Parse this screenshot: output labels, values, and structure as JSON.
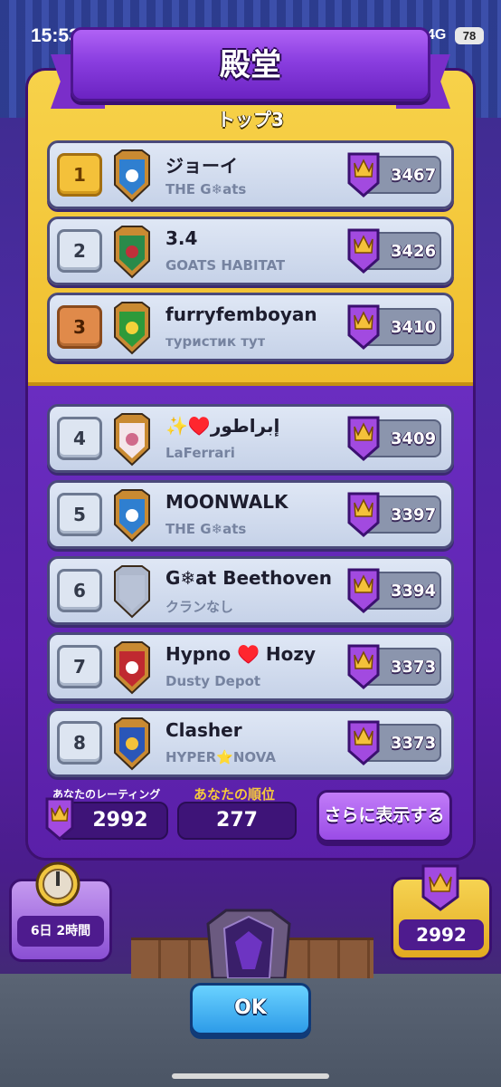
{
  "status_bar": {
    "time": "15:53",
    "network": "4G",
    "battery": "78"
  },
  "header": {
    "title": "殿堂"
  },
  "top_section": {
    "title": "トップ3"
  },
  "players": [
    {
      "rank": "1",
      "name": "ジョーイ",
      "clan": "THE G❄ats",
      "trophies": "3467",
      "badge": "snowflake-shield-icon"
    },
    {
      "rank": "2",
      "name": "3.4",
      "clan": "GOATS HABITAT",
      "trophies": "3426",
      "badge": "striped-shield-icon"
    },
    {
      "rank": "3",
      "name": "furryfemboyan",
      "clan": "туристик тут",
      "trophies": "3410",
      "badge": "brazil-shield-icon"
    },
    {
      "rank": "4",
      "name": "✨♥️إبراطور",
      "clan": "LaFerrari",
      "trophies": "3409",
      "badge": "flower-shield-icon"
    },
    {
      "rank": "5",
      "name": "MOONWALK",
      "clan": "THE G❄ats",
      "trophies": "3397",
      "badge": "snowflake-shield-icon"
    },
    {
      "rank": "6",
      "name": "G❄at Beethoven",
      "clan": "クランなし",
      "trophies": "3394",
      "badge": "empty-shield-icon"
    },
    {
      "rank": "7",
      "name": "Hypno ♥️ Hozy",
      "clan": "Dusty Depot",
      "trophies": "3373",
      "badge": "arrow-shield-icon"
    },
    {
      "rank": "8",
      "name": "Clasher",
      "clan": "HYPER⭐NOVA",
      "trophies": "3373",
      "badge": "star-shield-icon"
    }
  ],
  "footer": {
    "your_rating_label": "あなたのレーティング",
    "your_rating": "2992",
    "your_rank_label": "あなたの順位",
    "your_rank": "277",
    "more_button": "さらに表示する"
  },
  "bottom": {
    "season_timer": "6日 2時間",
    "trophies": "2992",
    "ok_button": "OK"
  },
  "colors": {
    "gold": "#f0bf2e",
    "purple": "#5a1fa8",
    "row": "#c6d2e8",
    "ok_blue": "#2d9be8"
  }
}
